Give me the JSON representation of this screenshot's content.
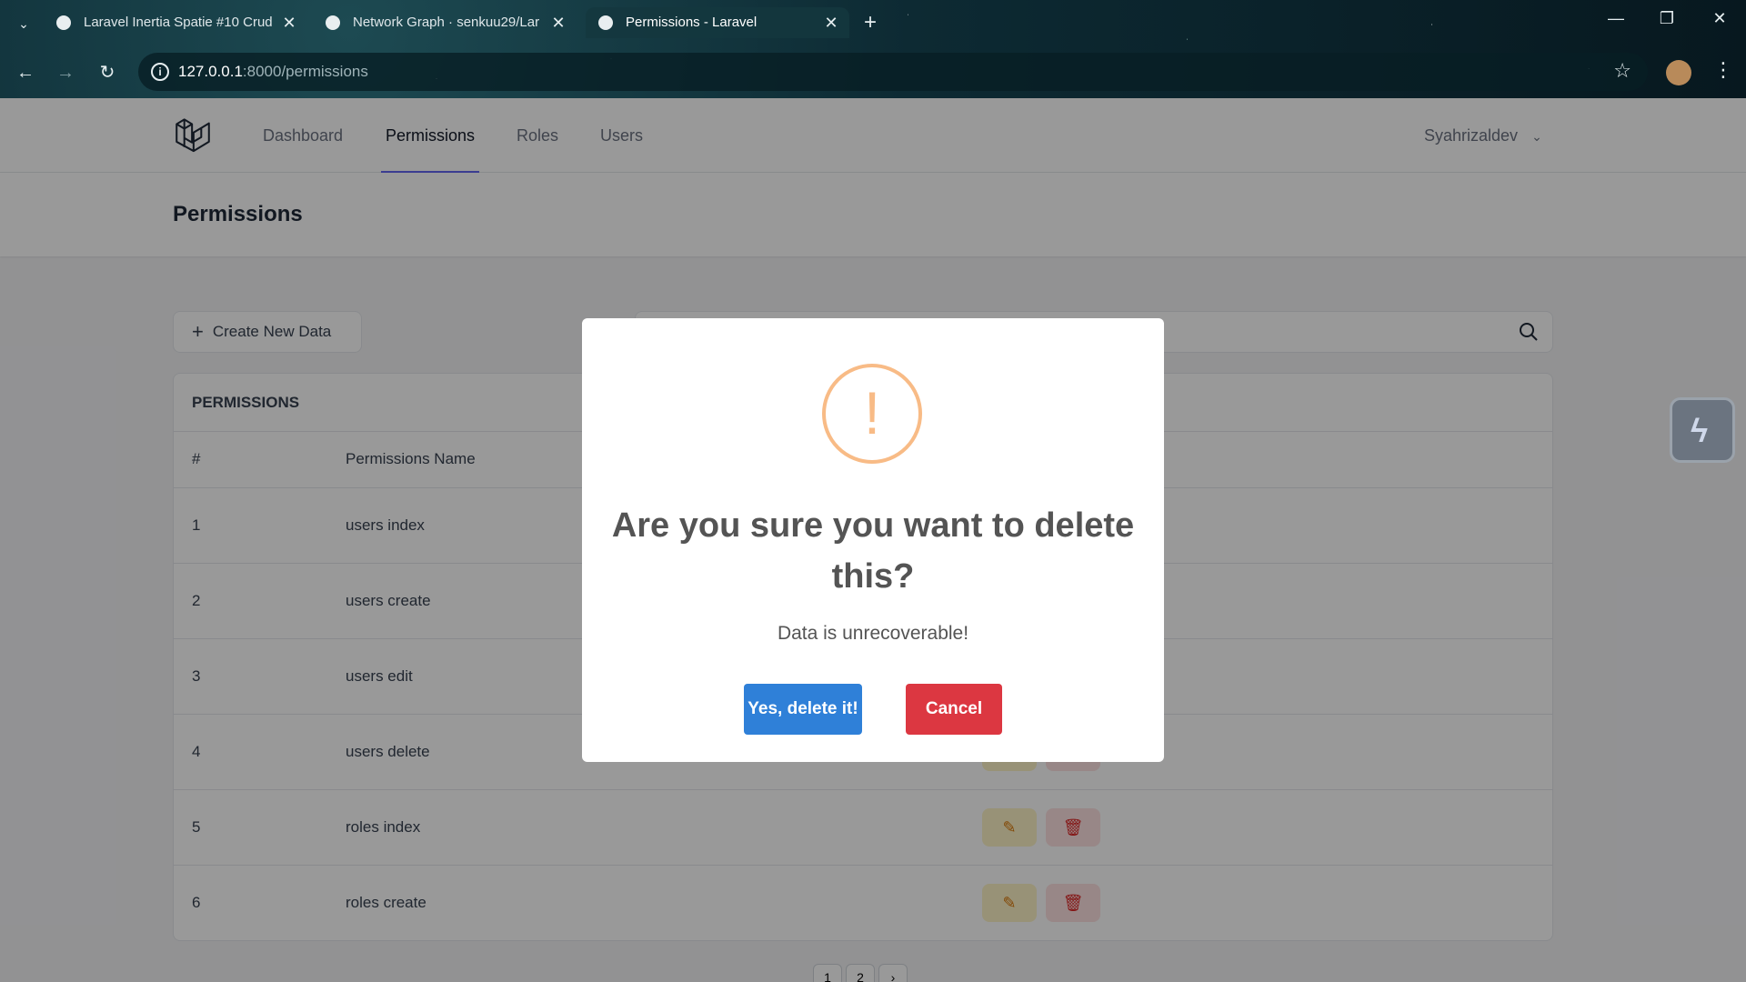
{
  "browser": {
    "tabs": [
      {
        "title": "Laravel Inertia Spatie #10 Crud",
        "active": false
      },
      {
        "title": "Network Graph · senkuu29/Lar",
        "active": false
      },
      {
        "title": "Permissions - Laravel",
        "active": true
      }
    ],
    "url_host": "127.0.0.1",
    "url_rest": ":8000/permissions"
  },
  "nav": {
    "links": [
      "Dashboard",
      "Permissions",
      "Roles",
      "Users"
    ],
    "active": "Permissions",
    "user": "Syahrizaldev"
  },
  "header": {
    "title": "Permissions"
  },
  "toolbar": {
    "create_label": "Create New Data",
    "search_placeholder": ""
  },
  "table": {
    "title": "PERMISSIONS",
    "columns": [
      "#",
      "Permissions Name"
    ],
    "rows": [
      {
        "num": "1",
        "name": "users index"
      },
      {
        "num": "2",
        "name": "users create"
      },
      {
        "num": "3",
        "name": "users edit"
      },
      {
        "num": "4",
        "name": "users delete"
      },
      {
        "num": "5",
        "name": "roles index"
      },
      {
        "num": "6",
        "name": "roles create"
      }
    ]
  },
  "pagination": [
    "1",
    "2",
    "›"
  ],
  "modal": {
    "icon": "warning-icon",
    "title": "Are you sure you want to delete this?",
    "text": "Data is unrecoverable!",
    "confirm_label": "Yes, delete it!",
    "cancel_label": "Cancel",
    "colors": {
      "confirm": "#2f80d8",
      "cancel": "#dc3741",
      "icon": "#f8bb86"
    }
  }
}
